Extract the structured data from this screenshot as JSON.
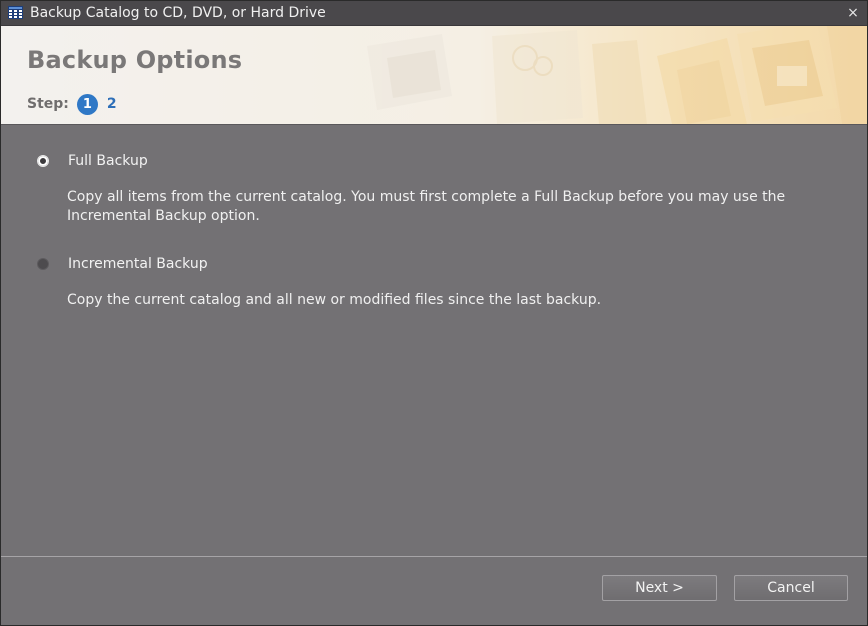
{
  "window": {
    "title": "Backup Catalog to CD, DVD, or Hard Drive",
    "close_glyph": "×",
    "app_icon": "grid-app-icon"
  },
  "header": {
    "title": "Backup Options",
    "step_label": "Step:",
    "current_step": "1",
    "next_step": "2"
  },
  "options": [
    {
      "label": "Full Backup",
      "selected": true,
      "description": "Copy all items from the current catalog. You must first complete a Full Backup before you may use the Incremental Backup option."
    },
    {
      "label": "Incremental Backup",
      "selected": false,
      "description": "Copy the current catalog and all new or modified files since the last backup."
    }
  ],
  "footer": {
    "next_label": "Next >",
    "cancel_label": "Cancel"
  },
  "colors": {
    "accent": "#2f78c6",
    "panel": "#737174",
    "titlebar": "#4a484b"
  }
}
